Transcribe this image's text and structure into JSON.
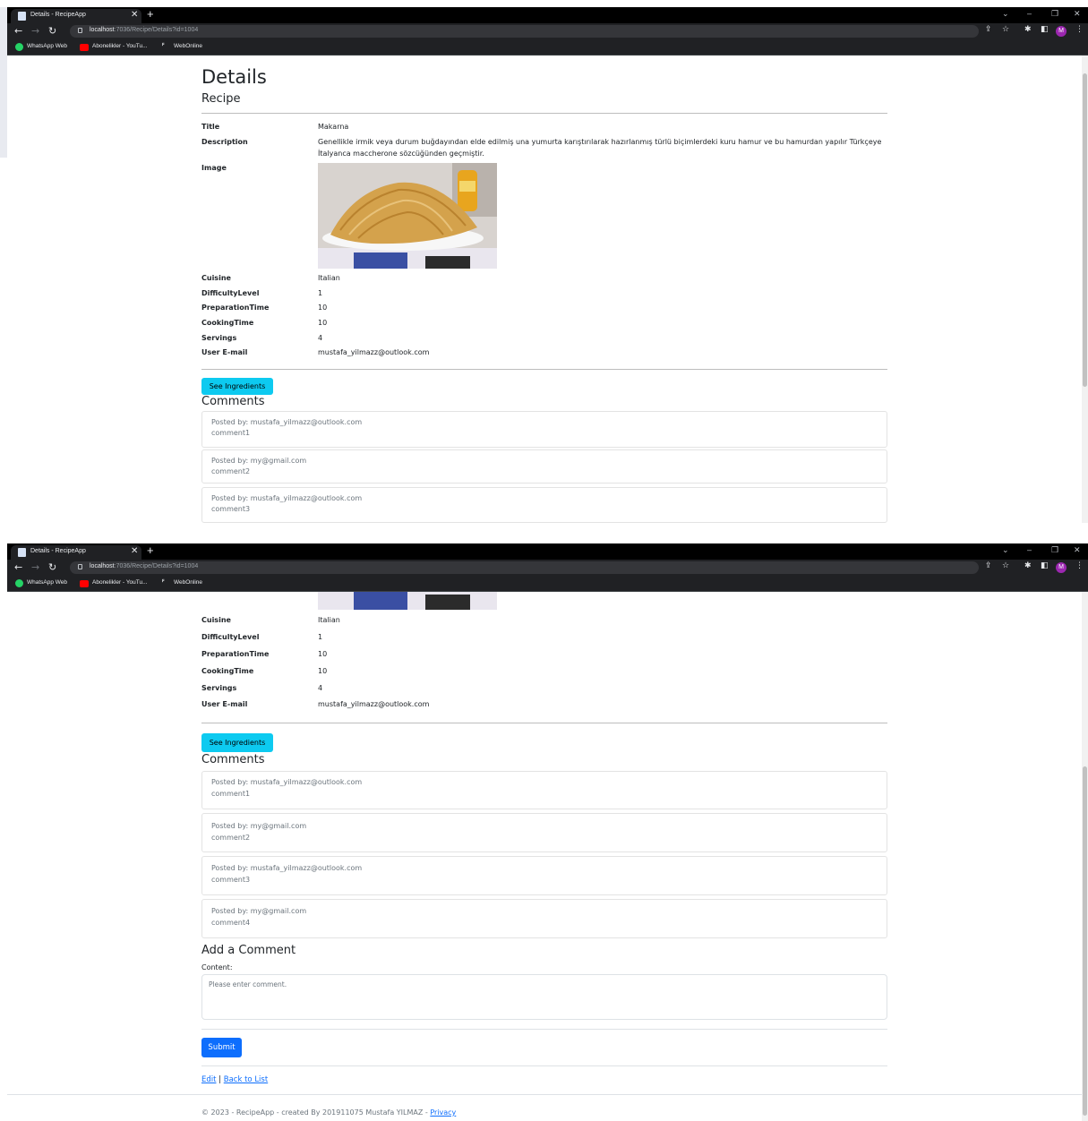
{
  "browser": {
    "tab_title": "Details - RecipeApp",
    "url_host": "localhost",
    "url_path": ":7036/Recipe/Details?id=1004",
    "profile_initial": "M",
    "bookmarks": [
      {
        "label": "WhatsApp Web",
        "icon": "whatsapp-icon"
      },
      {
        "label": "Abonelikler - YouTu...",
        "icon": "youtube-icon"
      },
      {
        "label": "WebOnline",
        "icon": "webonline-icon"
      }
    ]
  },
  "page": {
    "heading": "Details",
    "subheading": "Recipe",
    "fields": {
      "title_label": "Title",
      "title_value": "Makarna",
      "description_label": "Description",
      "description_value": "Genellikle irmik veya durum buğdayından elde edilmiş una yumurta karıştırılarak hazırlanmış türlü biçimlerdeki kuru hamur ve bu hamurdan yapılır Türkçeye İtalyanca maccherone sözcüğünden geçmiştir.",
      "image_label": "Image",
      "cuisine_label": "Cuisine",
      "cuisine_value": "Italian",
      "difficulty_label": "DifficultyLevel",
      "difficulty_value": "1",
      "prep_label": "PreparationTime",
      "prep_value": "10",
      "cook_label": "CookingTime",
      "cook_value": "10",
      "servings_label": "Servings",
      "servings_value": "4",
      "email_label": "User E-mail",
      "email_value": "mustafa_yilmazz@outlook.com"
    },
    "see_ingredients": "See Ingredients",
    "comments_heading": "Comments",
    "comments": [
      {
        "author": "Posted by: mustafa_yilmazz@outlook.com",
        "text": "comment1"
      },
      {
        "author": "Posted by: my@gmail.com",
        "text": "comment2"
      },
      {
        "author": "Posted by: mustafa_yilmazz@outlook.com",
        "text": "comment3"
      },
      {
        "author": "Posted by: my@gmail.com",
        "text": "comment4"
      }
    ],
    "add_comment_heading": "Add a Comment",
    "content_label": "Content:",
    "content_placeholder": "Please enter comment.",
    "submit_label": "Submit",
    "edit_link": "Edit",
    "link_separator": " | ",
    "back_link": "Back to List",
    "footer_text": "© 2023 - RecipeApp - created By 201911075 Mustafa YILMAZ - ",
    "privacy_link": "Privacy"
  }
}
